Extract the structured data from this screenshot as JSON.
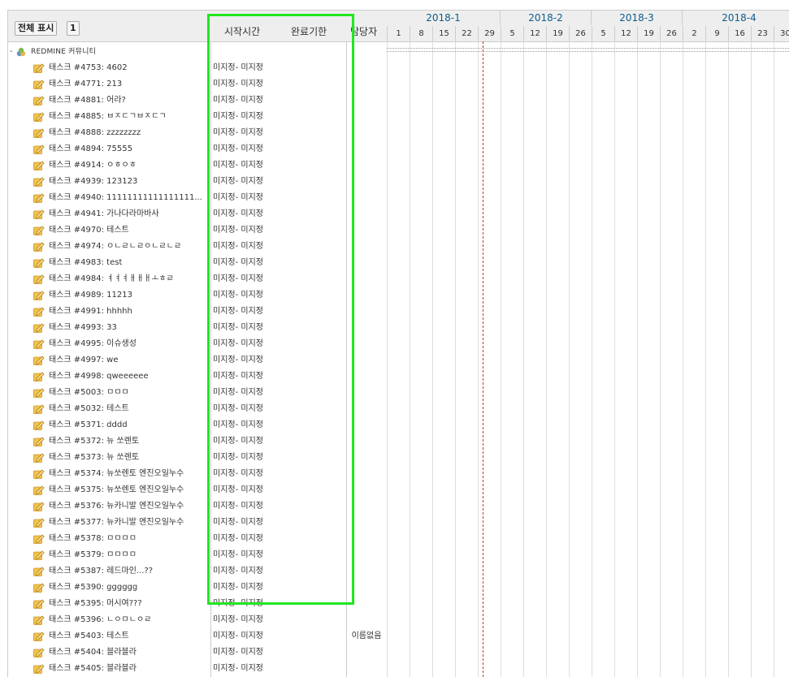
{
  "toolbar": {
    "show_all_label": "전체 표시",
    "level_label": "1"
  },
  "columns": {
    "start_label": "시작시간",
    "due_label": "완료기한",
    "assignee_label": "담당자"
  },
  "project": {
    "name": "REDMINE 커뮤니티",
    "toggle": "-"
  },
  "tasks": [
    {
      "label": "태스크 #4753: 4602",
      "dates": "미지정- 미지정"
    },
    {
      "label": "태스크 #4771: 213",
      "dates": "미지정- 미지정"
    },
    {
      "label": "태스크 #4881: 어라?",
      "dates": "미지정- 미지정"
    },
    {
      "label": "태스크 #4885: ㅂㅈㄷㄱㅂㅈㄷㄱ",
      "dates": "미지정- 미지정"
    },
    {
      "label": "태스크 #4888: zzzzzzzz",
      "dates": "미지정- 미지정"
    },
    {
      "label": "태스크 #4894: 75555",
      "dates": "미지정- 미지정"
    },
    {
      "label": "태스크 #4914: ㅇㅎㅇㅎ",
      "dates": "미지정- 미지정"
    },
    {
      "label": "태스크 #4939: 123123",
      "dates": "미지정- 미지정"
    },
    {
      "label": "태스크 #4940: 11111111111111111...",
      "dates": "미지정- 미지정"
    },
    {
      "label": "태스크 #4941: 가나다라마바사",
      "dates": "미지정- 미지정"
    },
    {
      "label": "태스크 #4970: 테스트",
      "dates": "미지정- 미지정"
    },
    {
      "label": "태스크 #4974: ㅇㄴㄹㄴㄹㅇㄴㄹㄴㄹ",
      "dates": "미지정- 미지정"
    },
    {
      "label": "태스크 #4983: test",
      "dates": "미지정- 미지정"
    },
    {
      "label": "태스크 #4984: ㅕㅕㅕㅐㅐㅐㅗㅎㄹ",
      "dates": "미지정- 미지정"
    },
    {
      "label": "태스크 #4989: 11213",
      "dates": "미지정- 미지정"
    },
    {
      "label": "태스크 #4991: hhhhh",
      "dates": "미지정- 미지정"
    },
    {
      "label": "태스크 #4993: 33",
      "dates": "미지정- 미지정"
    },
    {
      "label": "태스크 #4995: 이슈생성",
      "dates": "미지정- 미지정"
    },
    {
      "label": "태스크 #4997: we",
      "dates": "미지정- 미지정"
    },
    {
      "label": "태스크 #4998: qweeeeee",
      "dates": "미지정- 미지정"
    },
    {
      "label": "태스크 #5003: ㅁㅁㅁ",
      "dates": "미지정- 미지정"
    },
    {
      "label": "태스크 #5032: 테스트",
      "dates": "미지정- 미지정"
    },
    {
      "label": "태스크 #5371: dddd",
      "dates": "미지정- 미지정"
    },
    {
      "label": "태스크 #5372: 뉴 쏘렌토",
      "dates": "미지정- 미지정"
    },
    {
      "label": "태스크 #5373: 뉴 쏘렌토",
      "dates": "미지정- 미지정"
    },
    {
      "label": "태스크 #5374: 뉴쏘렌토 엔진오일누수",
      "dates": "미지정- 미지정"
    },
    {
      "label": "태스크 #5375: 뉴쏘렌토 엔진오일누수",
      "dates": "미지정- 미지정"
    },
    {
      "label": "태스크 #5376: 뉴카니발 엔진오일누수",
      "dates": "미지정- 미지정"
    },
    {
      "label": "태스크 #5377: 뉴카니발 엔진오일누수",
      "dates": "미지정- 미지정"
    },
    {
      "label": "태스크 #5378: ㅁㅁㅁㅁ",
      "dates": "미지정- 미지정"
    },
    {
      "label": "태스크 #5379: ㅁㅁㅁㅁ",
      "dates": "미지정- 미지정"
    },
    {
      "label": "태스크 #5387: 레드마인...??",
      "dates": "미지정- 미지정"
    },
    {
      "label": "태스크 #5390: gggggg",
      "dates": "미지정- 미지정"
    },
    {
      "label": "태스크 #5395: 머시여???",
      "dates": "미지정- 미지정"
    },
    {
      "label": "태스크 #5396: ㄴㅇㅁㄴㅇㄹ",
      "dates": "미지정- 미지정"
    },
    {
      "label": "태스크 #5403: 테스트",
      "dates": "미지정- 미지정",
      "assignee": "이름없음"
    },
    {
      "label": "태스크 #5404: 블라블라",
      "dates": "미지정- 미지정"
    },
    {
      "label": "태스크 #5405: 블라블라",
      "dates": "미지정- 미지정"
    }
  ],
  "gantt": {
    "months": [
      "2018-1",
      "2018-2",
      "2018-3",
      "2018-4"
    ],
    "days": [
      "1",
      "8",
      "15",
      "22",
      "29",
      "5",
      "12",
      "19",
      "26",
      "5",
      "12",
      "19",
      "26",
      "2",
      "9",
      "16",
      "23",
      "30"
    ]
  },
  "colors": {
    "highlight": "#22e622",
    "month_text": "#0d5c8c",
    "today_line": "#c0392b"
  },
  "icons": {
    "project": "project-globe-icon",
    "task": "task-pencil-icon"
  }
}
